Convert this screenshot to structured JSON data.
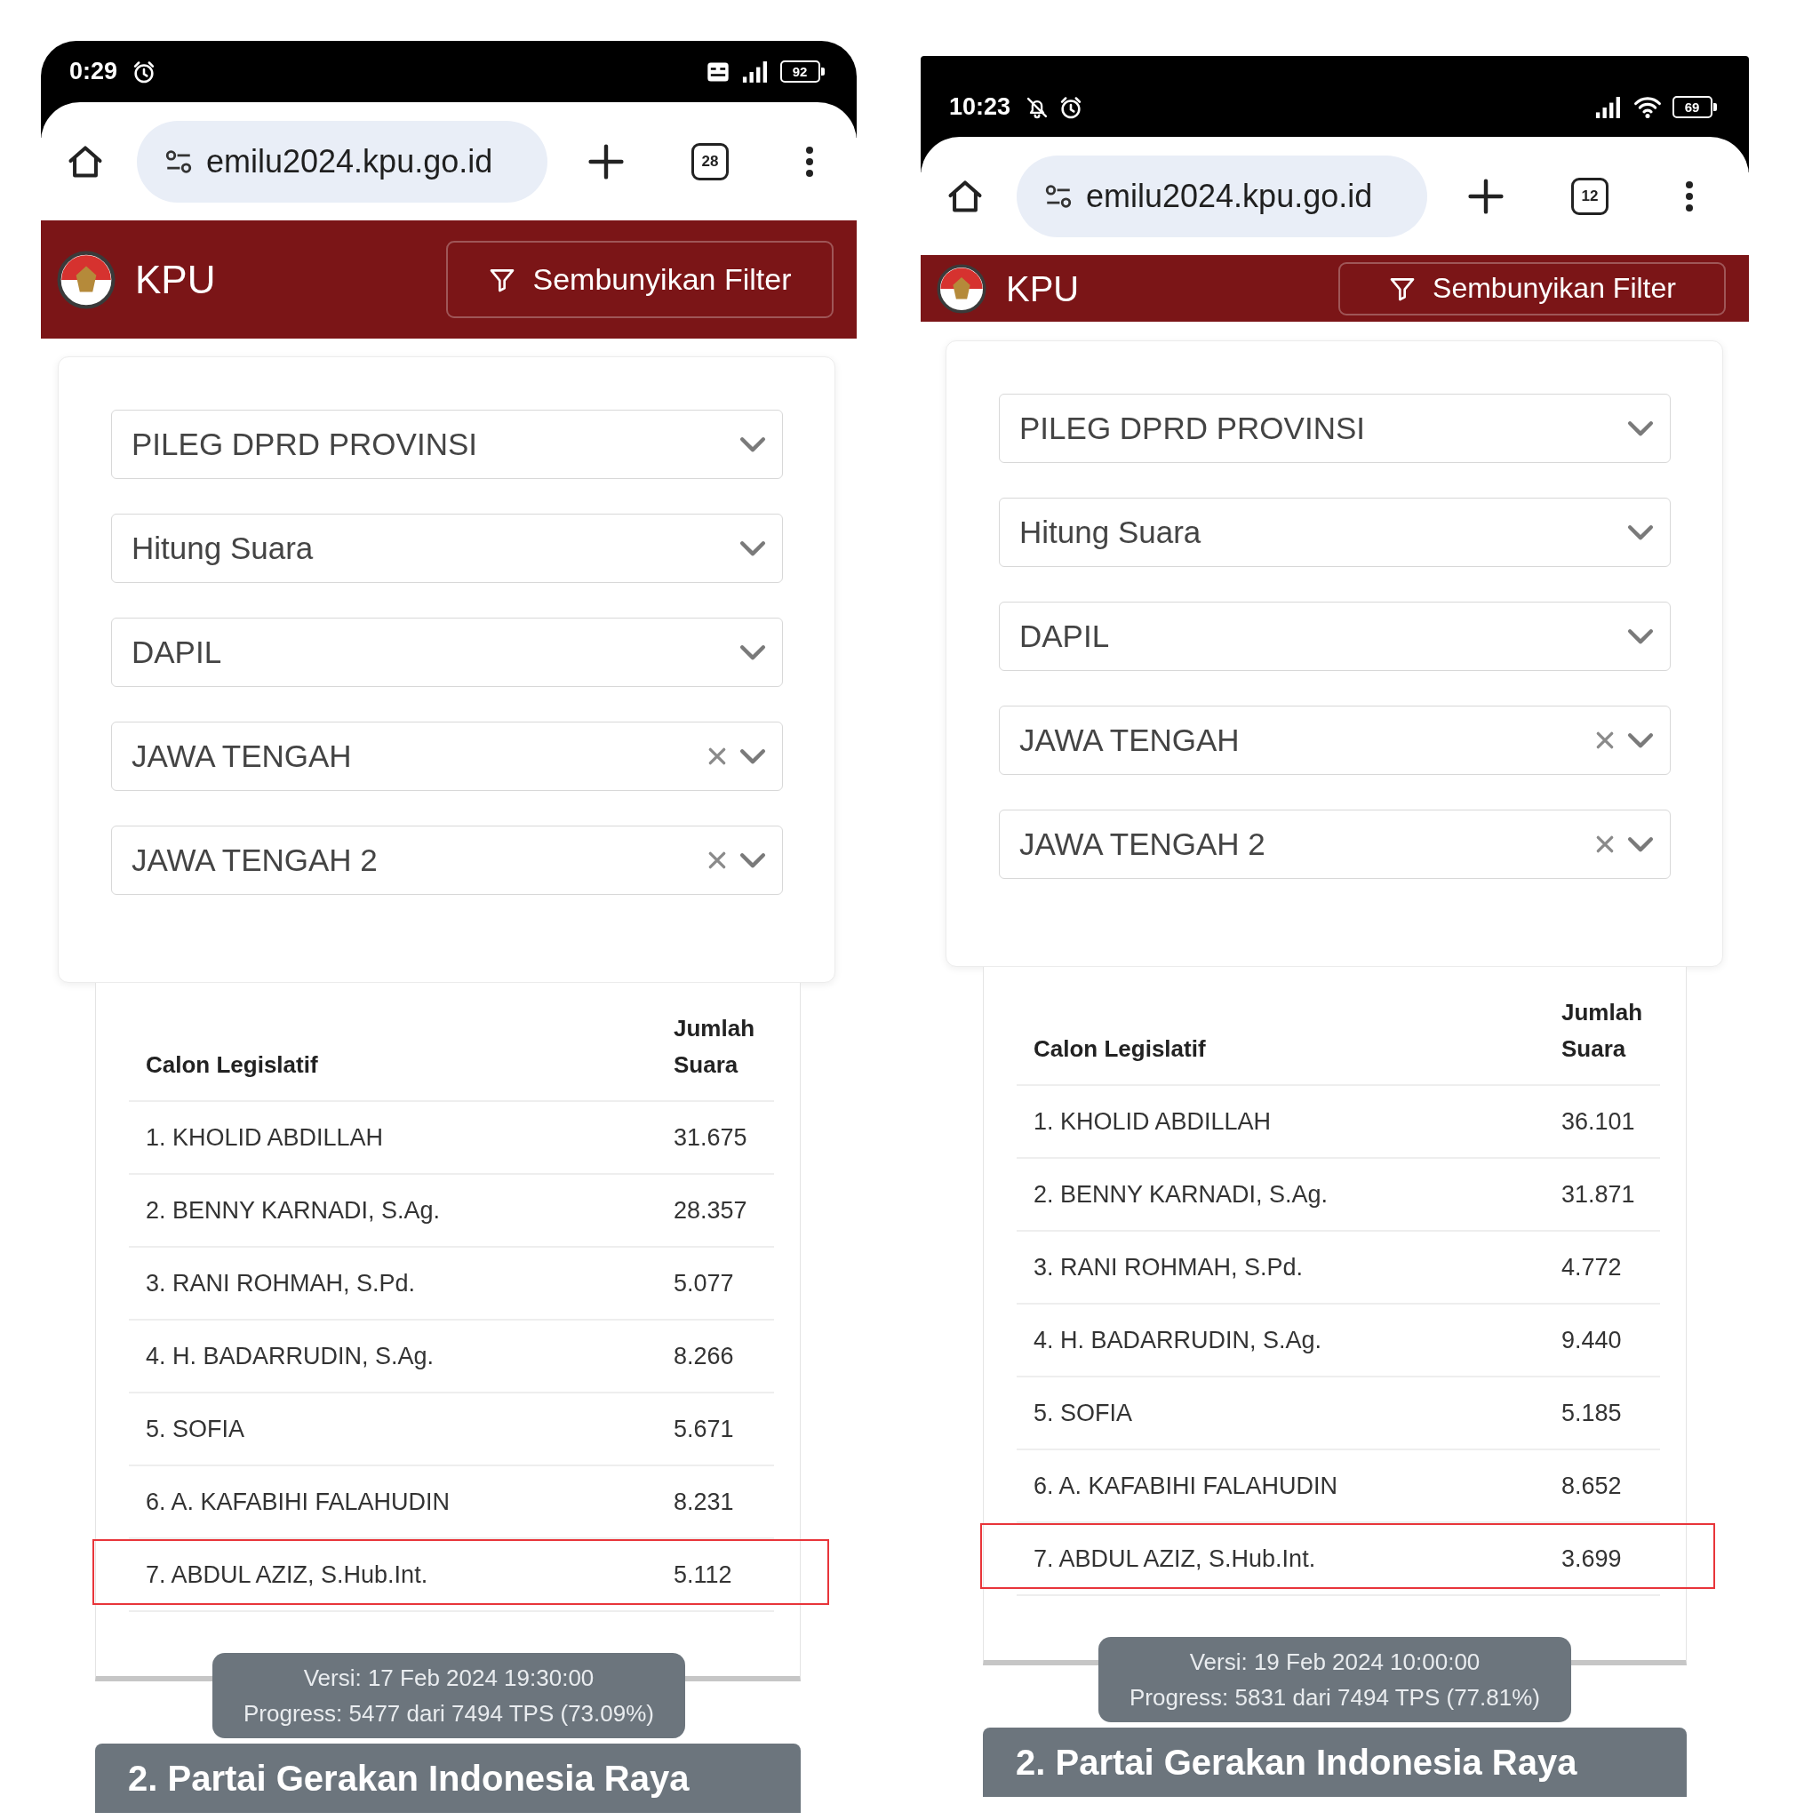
{
  "phones": [
    {
      "status_bar": {
        "time": "0:29",
        "notification_icons": [
          {
            "kind": "alarm"
          }
        ],
        "system_icons": [
          {
            "kind": "volte"
          },
          {
            "kind": "cellular"
          }
        ],
        "battery": "92"
      },
      "browser": {
        "url": "emilu2024.kpu.go.id",
        "tab_count": "28"
      },
      "header": {
        "title": "KPU",
        "filter_button": "Sembunyikan Filter"
      },
      "filters": [
        {
          "value": "PILEG DPRD PROVINSI",
          "clearable": false
        },
        {
          "value": "Hitung Suara",
          "clearable": false
        },
        {
          "value": "DAPIL",
          "clearable": false
        },
        {
          "value": "JAWA TENGAH",
          "clearable": true
        },
        {
          "value": "JAWA TENGAH 2",
          "clearable": true
        }
      ],
      "results_table": {
        "columns": [
          "Calon Legislatif",
          "Jumlah Suara"
        ],
        "rows": [
          {
            "name": "1. KHOLID ABDILLAH",
            "votes": "31.675",
            "highlighted": false
          },
          {
            "name": "2. BENNY KARNADI, S.Ag.",
            "votes": "28.357",
            "highlighted": false
          },
          {
            "name": "3. RANI ROHMAH, S.Pd.",
            "votes": "5.077",
            "highlighted": false
          },
          {
            "name": "4. H. BADARRUDIN, S.Ag.",
            "votes": "8.266",
            "highlighted": false
          },
          {
            "name": "5. SOFIA",
            "votes": "5.671",
            "highlighted": false
          },
          {
            "name": "6. A. KAFABIHI FALAHUDIN",
            "votes": "8.231",
            "highlighted": false
          },
          {
            "name": "7. ABDUL AZIZ, S.Hub.Int.",
            "votes": "5.112",
            "highlighted": true
          }
        ]
      },
      "version_tooltip": {
        "version": "Versi: 17 Feb 2024 19:30:00",
        "progress": "Progress: 5477 dari 7494 TPS (73.09%)"
      },
      "section_heading": "2. Partai Gerakan Indonesia Raya"
    },
    {
      "status_bar": {
        "time": "10:23",
        "notification_icons": [
          {
            "kind": "mute"
          },
          {
            "kind": "alarm"
          }
        ],
        "system_icons": [
          {
            "kind": "cellular"
          },
          {
            "kind": "wifi"
          }
        ],
        "battery": "69"
      },
      "browser": {
        "url": "emilu2024.kpu.go.id",
        "tab_count": "12"
      },
      "header": {
        "title": "KPU",
        "filter_button": "Sembunyikan Filter"
      },
      "filters": [
        {
          "value": "PILEG DPRD PROVINSI",
          "clearable": false
        },
        {
          "value": "Hitung Suara",
          "clearable": false
        },
        {
          "value": "DAPIL",
          "clearable": false
        },
        {
          "value": "JAWA TENGAH",
          "clearable": true
        },
        {
          "value": "JAWA TENGAH 2",
          "clearable": true
        }
      ],
      "results_table": {
        "columns": [
          "Calon Legislatif",
          "Jumlah Suara"
        ],
        "rows": [
          {
            "name": "1. KHOLID ABDILLAH",
            "votes": "36.101",
            "highlighted": false
          },
          {
            "name": "2. BENNY KARNADI, S.Ag.",
            "votes": "31.871",
            "highlighted": false
          },
          {
            "name": "3. RANI ROHMAH, S.Pd.",
            "votes": "4.772",
            "highlighted": false
          },
          {
            "name": "4. H. BADARRUDIN, S.Ag.",
            "votes": "9.440",
            "highlighted": false
          },
          {
            "name": "5. SOFIA",
            "votes": "5.185",
            "highlighted": false
          },
          {
            "name": "6. A. KAFABIHI FALAHUDIN",
            "votes": "8.652",
            "highlighted": false
          },
          {
            "name": "7. ABDUL AZIZ, S.Hub.Int.",
            "votes": "3.699",
            "highlighted": true
          }
        ]
      },
      "version_tooltip": {
        "version": "Versi: 19 Feb 2024 10:00:00",
        "progress": "Progress: 5831 dari 7494 TPS (77.81%)"
      },
      "section_heading": "2. Partai Gerakan Indonesia Raya"
    }
  ]
}
